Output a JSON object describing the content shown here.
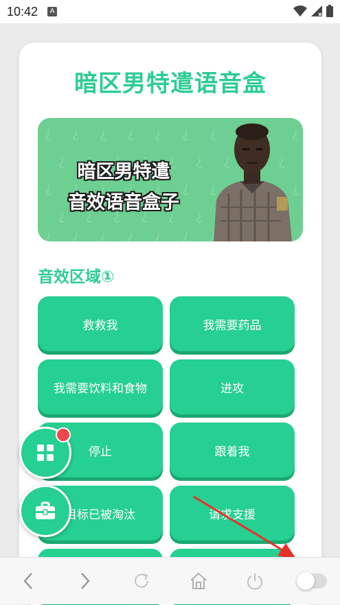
{
  "status_bar": {
    "time": "10:42",
    "notification_icon": "a-letter-icon",
    "icons": [
      "wifi-icon",
      "signal-icon",
      "battery-icon"
    ]
  },
  "app": {
    "title": "暗区男特遣语音盒",
    "banner": {
      "line1": "暗区男特遣",
      "line2": "音效语音盒子",
      "image": "soldier-portrait"
    },
    "section_title": "音效区域①",
    "buttons": [
      {
        "label": "救救我"
      },
      {
        "label": "我需要药品"
      },
      {
        "label": "我需要饮料和食物"
      },
      {
        "label": "进攻"
      },
      {
        "label": "停止"
      },
      {
        "label": "跟着我"
      },
      {
        "label": "目标已被淘汰"
      },
      {
        "label": "请求支援"
      },
      {
        "label": ""
      },
      {
        "label": ""
      }
    ]
  },
  "floating": {
    "apps_button": "apps-grid-icon",
    "toolbox_button": "toolbox-icon"
  },
  "bottom_nav": {
    "items": [
      "back-icon",
      "forward-icon",
      "refresh-icon",
      "home-icon",
      "power-icon",
      "toggle-switch"
    ]
  },
  "colors": {
    "accent": "#26cf92",
    "title": "#2ecc94",
    "banner": "#6dcf92",
    "badge": "#f0474f",
    "arrow": "#e8302a"
  }
}
